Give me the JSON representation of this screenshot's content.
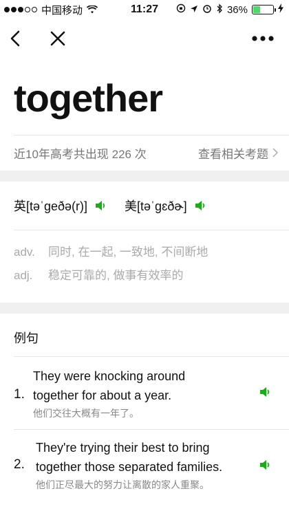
{
  "status": {
    "carrier": "中国移动",
    "time": "11:27",
    "battery_percent": "36%",
    "battery_level": 0.36,
    "signal_bars": 3,
    "signal_total": 5
  },
  "nav": {
    "back_icon": "chevron-left-icon",
    "close_icon": "close-icon",
    "more_icon": "more-dots-icon"
  },
  "word": "together",
  "stats": {
    "appearances": "近10年高考共出现 226 次",
    "related_link": "查看相关考题"
  },
  "pronunciation": {
    "uk": "英[təˈɡeðə(r)]",
    "us": "美[təˈɡɛðɚ]"
  },
  "definitions": [
    {
      "pos": "adv.",
      "meaning": "同时, 在一起, 一致地, 不间断地"
    },
    {
      "pos": "adj.",
      "meaning": "稳定可靠的, 做事有效率的"
    }
  ],
  "examples_title": "例句",
  "examples": [
    {
      "number": "1.",
      "en_line1": "They were knocking around",
      "en_line2": "together for about a year.",
      "cn": "他们交往大概有一年了。"
    },
    {
      "number": "2.",
      "en_line1": "They're trying their best to bring",
      "en_line2": "together those separated families.",
      "cn": "他们正尽最大的努力让离散的家人重聚。"
    }
  ],
  "colors": {
    "speaker": "#1aad19",
    "gap": "#f0f0f2"
  }
}
